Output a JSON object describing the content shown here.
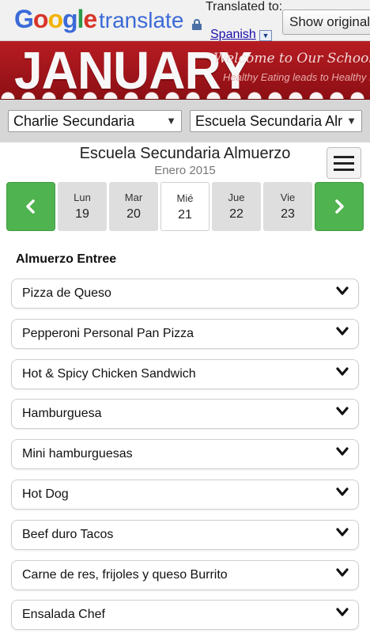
{
  "translate_bar": {
    "logo": "Google",
    "word": "translate",
    "translated_to": "Translated to:",
    "language": "Spanish",
    "show_original": "Show original"
  },
  "banner": {
    "title": "JANUARY",
    "welcome": "Welcome to Our School District",
    "subtitle": "Healthy Eating leads to Healthy Living"
  },
  "selectors": {
    "school": "Charlie Secundaria",
    "menu": "Escuela Secundaria Alr"
  },
  "header": {
    "title": "Escuela Secundaria Almuerzo",
    "month": "Enero 2015"
  },
  "days": [
    {
      "name": "Lun",
      "num": "19"
    },
    {
      "name": "Mar",
      "num": "20"
    },
    {
      "name": "Mié",
      "num": "21"
    },
    {
      "name": "Jue",
      "num": "22"
    },
    {
      "name": "Vie",
      "num": "23"
    }
  ],
  "section": {
    "heading": "Almuerzo Entree",
    "items": [
      "Pizza de Queso",
      "Pepperoni Personal Pan Pizza",
      "Hot & Spicy Chicken Sandwich",
      "Hamburguesa",
      "Mini hamburguesas",
      "Hot Dog",
      "Beef duro Tacos",
      "Carne de res, frijoles y queso Burrito",
      "Ensalada Chef"
    ]
  }
}
